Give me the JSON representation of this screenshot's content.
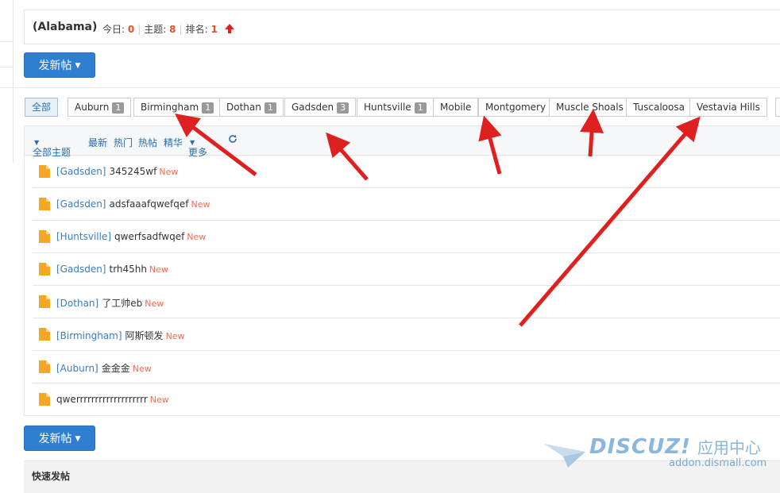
{
  "forum": {
    "name": "(Alabama)",
    "today_label": "今日:",
    "today_value": "0",
    "topics_label": "主题:",
    "topics_value": "8",
    "rank_label": "排名:",
    "rank_value": "1"
  },
  "post_button": {
    "label": "发新帖"
  },
  "tags": [
    {
      "label": "全部",
      "count": ""
    },
    {
      "label": "Auburn",
      "count": "1"
    },
    {
      "label": "Birmingham",
      "count": "1"
    },
    {
      "label": "Dothan",
      "count": "1"
    },
    {
      "label": "Gadsden",
      "count": "3"
    },
    {
      "label": "Huntsville",
      "count": "1"
    },
    {
      "label": "Mobile",
      "count": ""
    },
    {
      "label": "Montgomery",
      "count": ""
    },
    {
      "label": "Muscle Shoals",
      "count": ""
    },
    {
      "label": "Tuscaloosa",
      "count": ""
    },
    {
      "label": "Vestavia Hills",
      "count": ""
    }
  ],
  "filters": {
    "all_topics": "全部主题",
    "latest": "最新",
    "hot": "热门",
    "hot_posts": "热帖",
    "digest": "精华",
    "more": "更多"
  },
  "threads": [
    {
      "type": "[Gadsden]",
      "title": "345245wf",
      "badge": "New"
    },
    {
      "type": "[Gadsden]",
      "title": "adsfaaafqwefqef",
      "badge": "New"
    },
    {
      "type": "[Huntsville]",
      "title": "qwerfsadfwqef",
      "badge": "New"
    },
    {
      "type": "[Gadsden]",
      "title": "trh45hh",
      "badge": "New"
    },
    {
      "type": "[Dothan]",
      "title": "了工帅eb",
      "badge": "New"
    },
    {
      "type": "[Birmingham]",
      "title": "阿斯顿发",
      "badge": "New"
    },
    {
      "type": "[Auburn]",
      "title": "金金金",
      "badge": "New"
    },
    {
      "type": "",
      "title": "qwerrrrrrrrrrrrrrrrrrr",
      "badge": "New"
    }
  ],
  "quick_post": {
    "label": "快速发帖"
  },
  "watermark": {
    "brand": "DISCUZ!",
    "cn": "应用中心",
    "url": "addon.dismall.com"
  },
  "colors": {
    "accent": "#2f7fd1",
    "count_red": "#e0502a",
    "new_badge": "#f26c4f",
    "type_link": "#3a7cbf",
    "arrow_red": "#e02020",
    "doc_icon": "#f5a623"
  },
  "icons": [
    "rank-up-arrow-icon",
    "caret-down-icon",
    "refresh-icon",
    "document-icon"
  ]
}
